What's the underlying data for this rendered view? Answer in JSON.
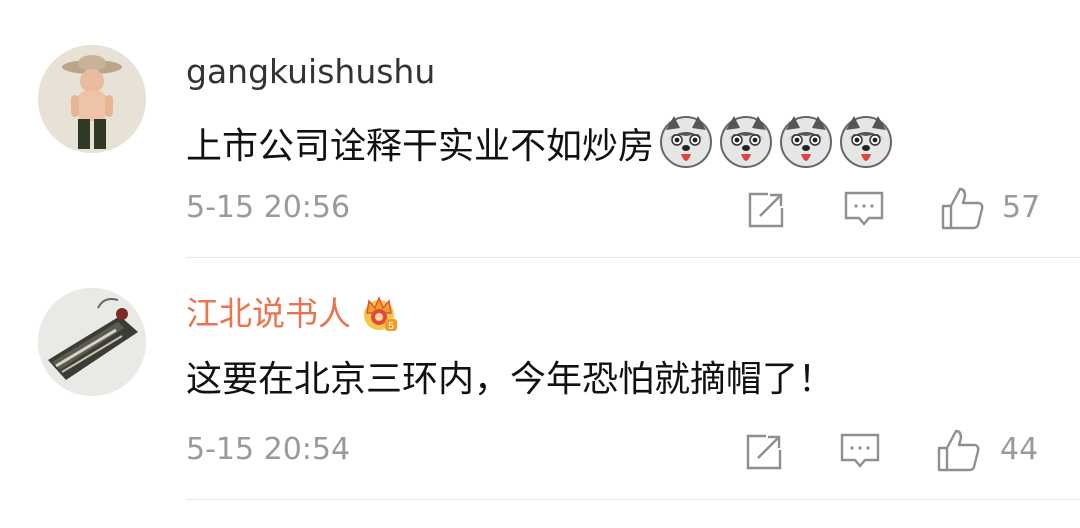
{
  "comments": [
    {
      "username": "gangkuishushu",
      "text": "上市公司诠释干实业不如炒房",
      "emoji_name": "husky-dog-emoji",
      "emoji_count": 4,
      "time": "5-15 20:56",
      "likes": "57",
      "vip": false
    },
    {
      "username": "江北说书人",
      "text": "这要在北京三环内，今年恐怕就摘帽了！",
      "time": "5-15 20:54",
      "likes": "44",
      "vip": true,
      "badge_icon": "crown-badge-icon"
    }
  ],
  "icons": {
    "share": "share-icon",
    "reply": "comment-icon",
    "like": "thumbs-up-icon"
  },
  "colors": {
    "username_default": "#333333",
    "username_vip": "#eb7350",
    "meta_gray": "#9a9a9a",
    "divider": "#e6e6e6"
  }
}
